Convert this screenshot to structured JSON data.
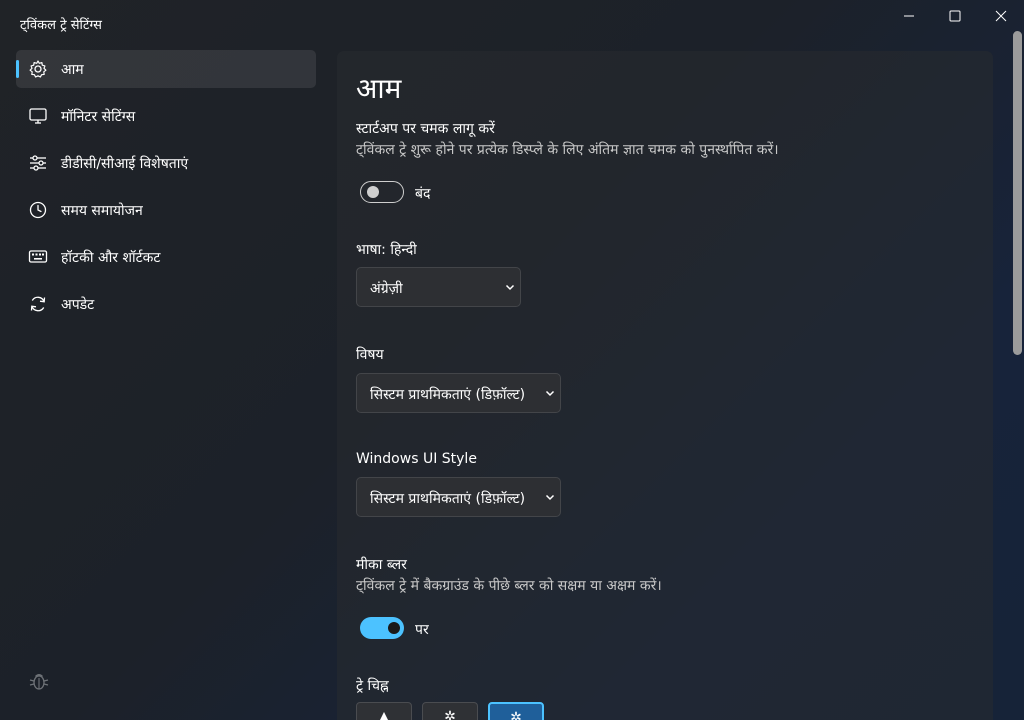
{
  "window": {
    "title": "ट्विंकल ट्रे सेटिंग्स",
    "minimize_icon": "minimize-icon",
    "maximize_icon": "maximize-icon",
    "close_icon": "close-icon"
  },
  "sidebar": {
    "items": [
      {
        "label": "आम",
        "icon": "gear-icon",
        "active": true
      },
      {
        "label": "मॉनिटर सेटिंग्स",
        "icon": "monitor-icon",
        "active": false
      },
      {
        "label": "डीडीसी/सीआई विशेषताएं",
        "icon": "sliders-icon",
        "active": false
      },
      {
        "label": "समय समायोजन",
        "icon": "clock-icon",
        "active": false
      },
      {
        "label": "हॉटकी और शॉर्टकट",
        "icon": "keyboard-icon",
        "active": false
      },
      {
        "label": "अपडेट",
        "icon": "refresh-icon",
        "active": false
      }
    ],
    "bottom_icon": "bug-icon"
  },
  "main": {
    "title": "आम",
    "startup": {
      "label": "स्टार्टअप पर चमक लागू करें",
      "description": "ट्विंकल ट्रे शुरू होने पर प्रत्येक डिस्प्ले के लिए अंतिम ज्ञात चमक को पुनर्स्थापित करें।",
      "toggle_state": "बंद",
      "enabled": false
    },
    "language": {
      "label": "भाषा: हिन्दी",
      "selected": "अंग्रेज़ी"
    },
    "theme": {
      "label": "विषय",
      "selected": "सिस्टम प्राथमिकताएं (डिफ़ॉल्ट)"
    },
    "windows_ui_style": {
      "label": "Windows UI Style",
      "selected": "सिस्टम प्राथमिकताएं (डिफ़ॉल्ट)"
    },
    "mica_blur": {
      "label": "मीका ब्लर",
      "description": "ट्विंकल ट्रे में बैकग्राउंड के पीछे ब्लर को सक्षम या अक्षम करें।",
      "toggle_state": "पर",
      "enabled": true
    },
    "tray_icon": {
      "label": "ट्रे चिह्न",
      "selected_index": 2
    }
  },
  "colors": {
    "accent": "#4cc2ff",
    "background": "#1c2129"
  }
}
